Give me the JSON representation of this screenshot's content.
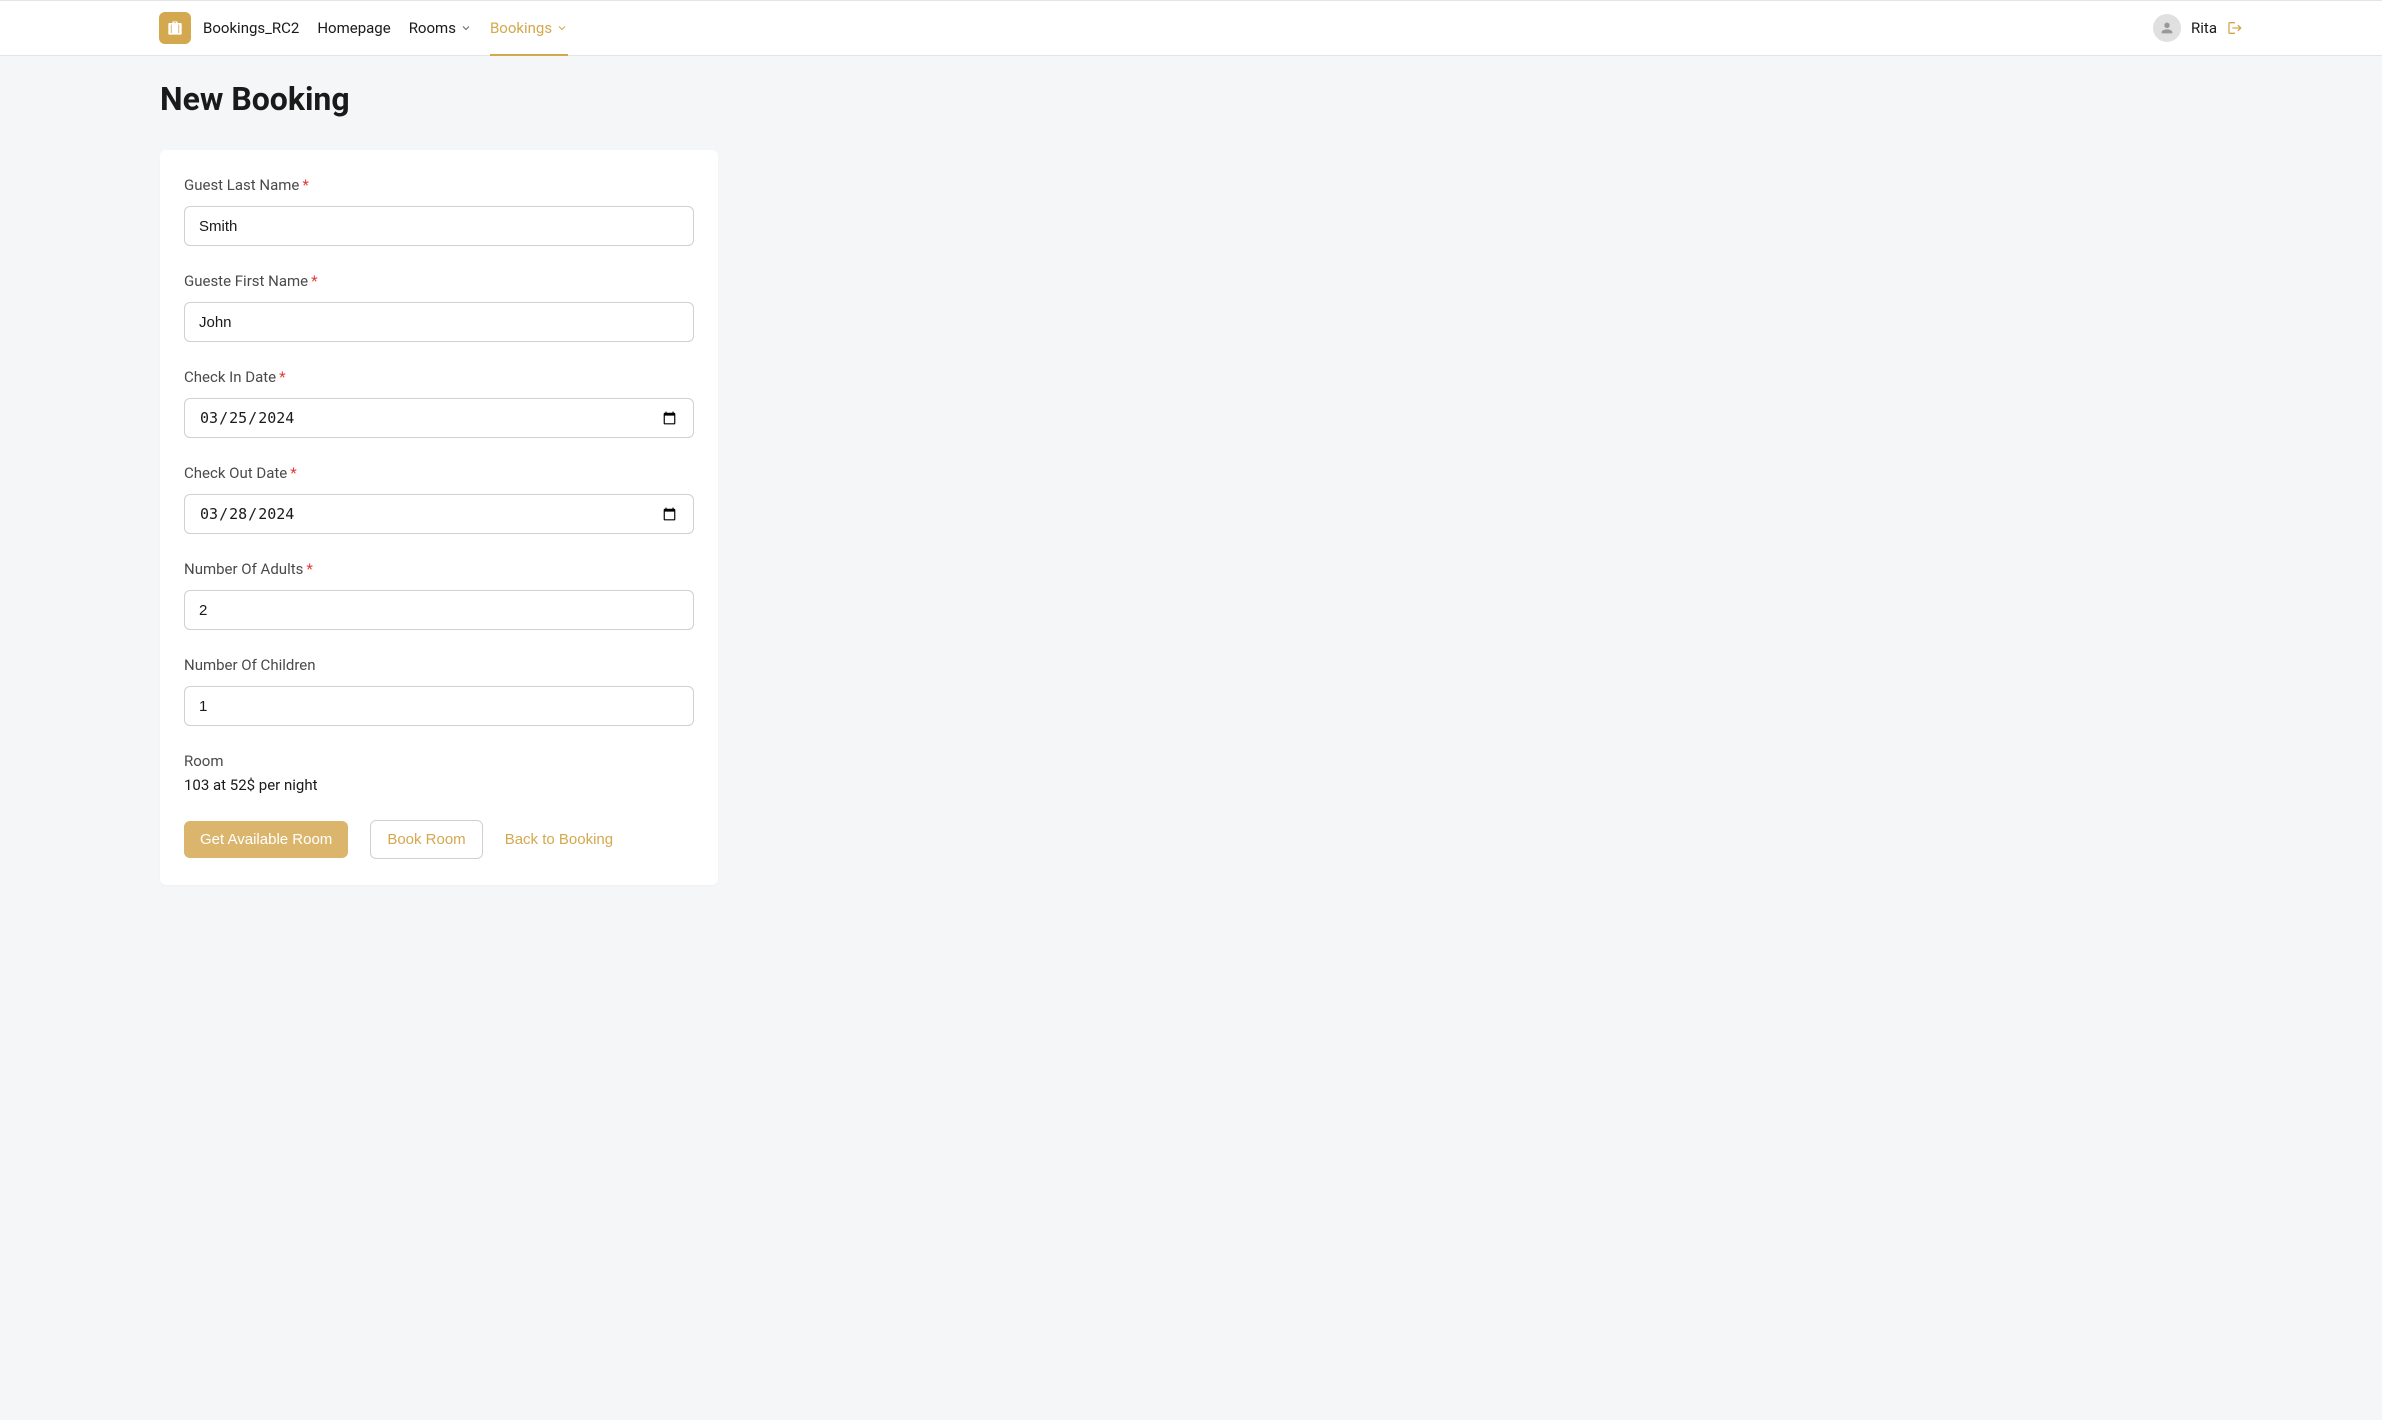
{
  "header": {
    "app_name": "Bookings_RC2",
    "nav": [
      {
        "label": "Homepage",
        "active": false,
        "has_dropdown": false
      },
      {
        "label": "Rooms",
        "active": false,
        "has_dropdown": true
      },
      {
        "label": "Bookings",
        "active": true,
        "has_dropdown": true
      }
    ],
    "user_name": "Rita"
  },
  "page": {
    "title": "New Booking"
  },
  "form": {
    "guest_last_name": {
      "label": "Guest Last Name",
      "required": true,
      "value": "Smith"
    },
    "guest_first_name": {
      "label": "Gueste First Name",
      "required": true,
      "value": "John"
    },
    "check_in_date": {
      "label": "Check In Date",
      "required": true,
      "value": "2024-03-25",
      "display_value": "25/03/2024"
    },
    "check_out_date": {
      "label": "Check Out Date",
      "required": true,
      "value": "2024-03-28",
      "display_value": "28/03/2024"
    },
    "adults": {
      "label": "Number Of Adults",
      "required": true,
      "value": "2"
    },
    "children": {
      "label": "Number Of Children",
      "required": false,
      "value": "1"
    },
    "room": {
      "label": "Room",
      "value": "103 at 52$ per night"
    }
  },
  "buttons": {
    "get_available_room": "Get Available Room",
    "book_room": "Book Room",
    "back_to_booking": "Back to Booking"
  }
}
